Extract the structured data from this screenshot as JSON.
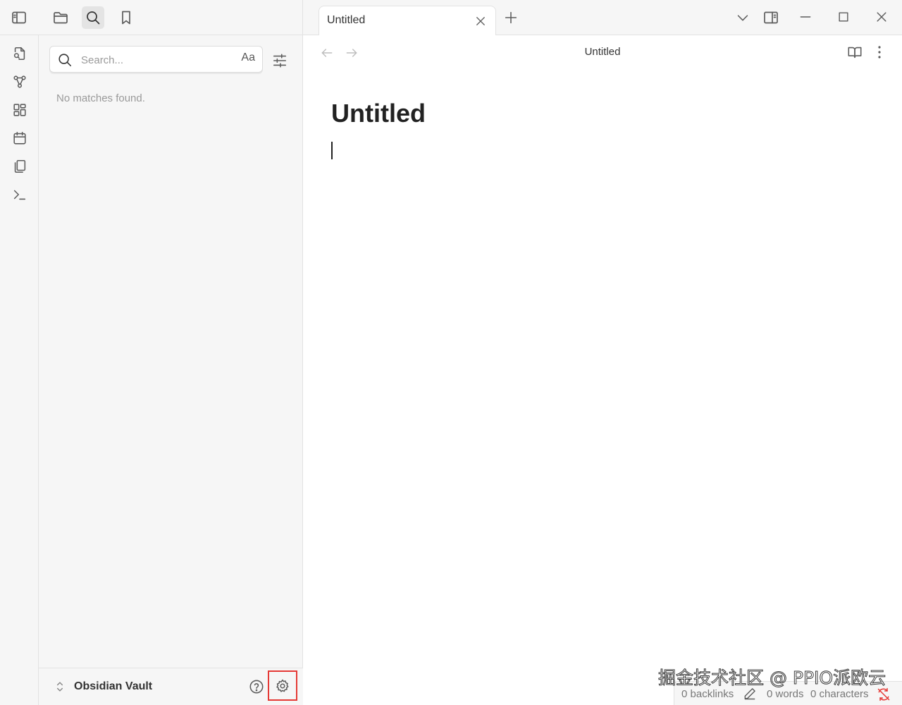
{
  "topbar": {
    "left_buttons": [
      {
        "icon": "sidebar-toggle-icon"
      },
      {
        "icon": "folder-icon"
      },
      {
        "icon": "search-icon",
        "active": true
      },
      {
        "icon": "bookmark-icon"
      }
    ]
  },
  "ribbon": {
    "items": [
      {
        "icon": "open-quick-switcher-icon"
      },
      {
        "icon": "graph-view-icon"
      },
      {
        "icon": "canvas-icon"
      },
      {
        "icon": "daily-note-calendar-icon"
      },
      {
        "icon": "templates-icon"
      },
      {
        "icon": "command-palette-icon"
      }
    ]
  },
  "search": {
    "placeholder": "Search...",
    "value": "",
    "case_label": "Aa",
    "empty_message": "No matches found."
  },
  "vault": {
    "name": "Obsidian Vault"
  },
  "tabs": [
    {
      "label": "Untitled",
      "active": true
    }
  ],
  "editor": {
    "view_title": "Untitled",
    "note_title": "Untitled"
  },
  "status": {
    "backlinks": "0 backlinks",
    "words": "0 words",
    "characters": "0 characters"
  },
  "watermark": {
    "text": "掘金技术社区 @ PPIO派欧云"
  },
  "colors": {
    "highlight_box": "#e53935",
    "sidebar_bg": "#f6f6f6",
    "sync_error": "#e53935"
  }
}
